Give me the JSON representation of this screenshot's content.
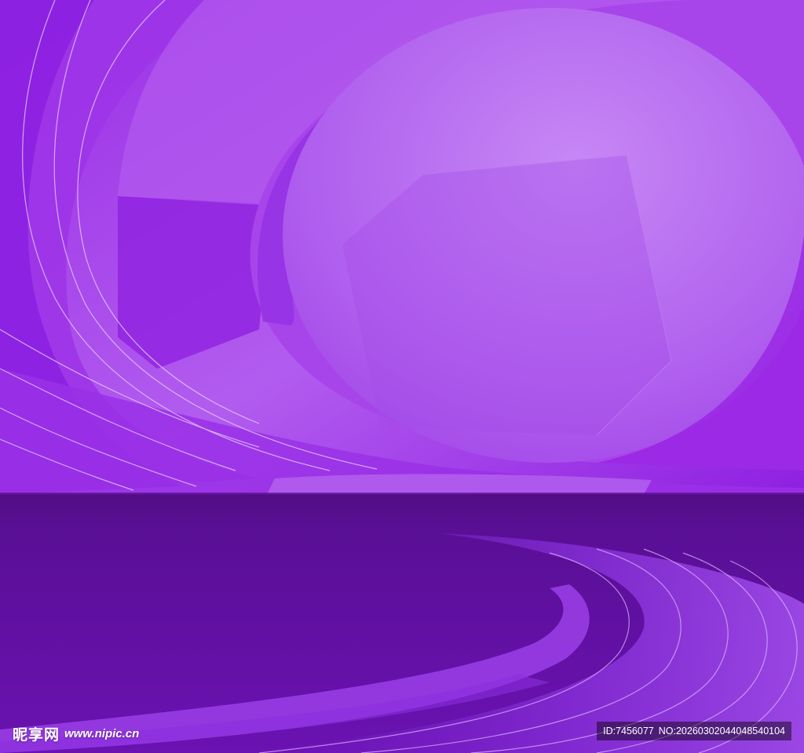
{
  "background": {
    "description_colors": {
      "upper_light": "#c07ef2",
      "upper_mid": "#a647ea",
      "upper_deep": "#8a1ce0",
      "floor_band": "#540f86",
      "floor_deep": "#5e0ea2",
      "floor_glow": "#8b2fe0",
      "arc_line": "#e6c7ff"
    }
  },
  "watermark": {
    "brand": "昵享网",
    "site": "www.nipic.cn"
  },
  "id_badge": {
    "id_text": "ID:7456077",
    "no_text": "NO:20260302044048540104"
  }
}
